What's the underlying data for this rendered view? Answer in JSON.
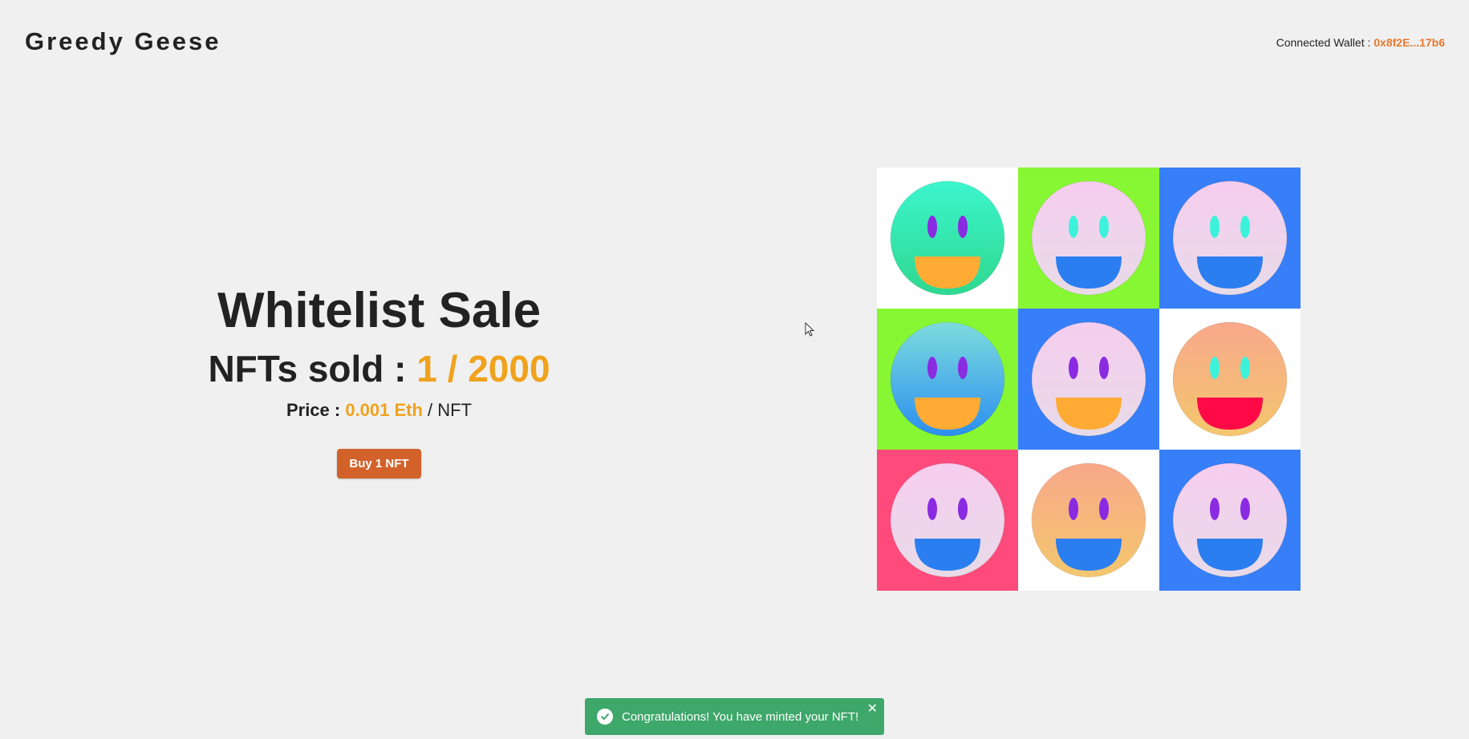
{
  "header": {
    "logo": "Greedy Geese",
    "wallet_label": "Connected Wallet : ",
    "wallet_address": "0x8f2E...17b6"
  },
  "sale": {
    "title": "Whitelist Sale",
    "sold_label": "NFTs sold : ",
    "sold_value": "1 / 2000",
    "price_label": "Price : ",
    "price_value": "0.001 Eth",
    "price_unit": " / NFT",
    "buy_label": "Buy 1 NFT"
  },
  "colors": {
    "accent": "#f0a21d",
    "wallet_accent": "#e8772e",
    "button": "#d2622a",
    "toast": "#3ea76a",
    "background": "#f0f0f0"
  },
  "gallery": {
    "tiles": [
      {
        "bg": "#ffffff",
        "face": [
          "#3cf5cc",
          "#2fd88f"
        ],
        "eyes": "#8a2be2",
        "mouth": "#ffab34"
      },
      {
        "bg": "#88f733",
        "face": [
          "#f6cdef",
          "#e8dbe8"
        ],
        "eyes": "#3cf2da",
        "mouth": "#2b7ef0"
      },
      {
        "bg": "#377ff8",
        "face": [
          "#f6cdef",
          "#e8dbe8"
        ],
        "eyes": "#3cf2da",
        "mouth": "#2b7ef0"
      },
      {
        "bg": "#88f733",
        "face": [
          "#7ddcdc",
          "#2b8ff0"
        ],
        "eyes": "#8a2be2",
        "mouth": "#ffab34"
      },
      {
        "bg": "#377ff8",
        "face": [
          "#f6cdef",
          "#e8dbe8"
        ],
        "eyes": "#8a2be2",
        "mouth": "#ffab34"
      },
      {
        "bg": "#ffffff",
        "face": [
          "#f8a88a",
          "#f4c76e"
        ],
        "eyes": "#3cf2da",
        "mouth": "#ff0a46"
      },
      {
        "bg": "#ff4b7c",
        "face": [
          "#f6cdef",
          "#e8dbe8"
        ],
        "eyes": "#8a2be2",
        "mouth": "#2b7ef0"
      },
      {
        "bg": "#ffffff",
        "face": [
          "#f8a88a",
          "#f4c76e"
        ],
        "eyes": "#8a2be2",
        "mouth": "#2b7ef0"
      },
      {
        "bg": "#377ff8",
        "face": [
          "#f6cdef",
          "#e8dbe8"
        ],
        "eyes": "#8a2be2",
        "mouth": "#2b7ef0"
      }
    ]
  },
  "toast": {
    "message": "Congratulations! You have minted your NFT!",
    "icon": "check-circle-icon",
    "close_icon": "close-icon"
  }
}
